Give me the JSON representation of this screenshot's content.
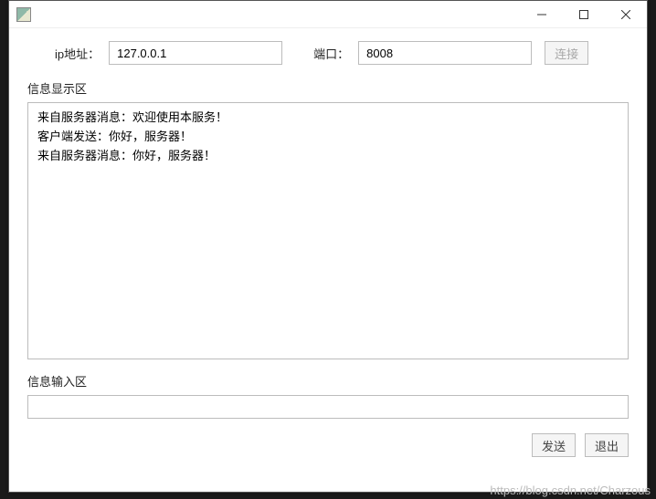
{
  "connection": {
    "ip_label": "ip地址：",
    "ip_value": "127.0.0.1",
    "port_label": "端口：",
    "port_value": "8008",
    "connect_label": "连接"
  },
  "display": {
    "title": "信息显示区",
    "content": "来自服务器消息：欢迎使用本服务！\n客户端发送：你好，服务器！\n来自服务器消息：你好，服务器！"
  },
  "input": {
    "title": "信息输入区",
    "value": ""
  },
  "actions": {
    "send_label": "发送",
    "exit_label": "退出"
  },
  "watermark": "https://blog.csdn.net/Charzous"
}
